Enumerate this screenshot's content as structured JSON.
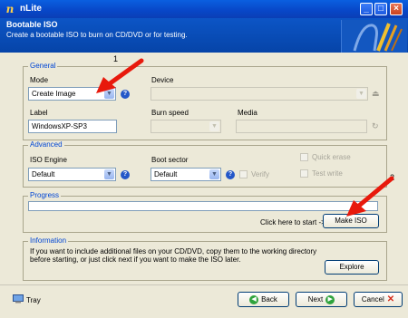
{
  "window": {
    "title": "nLite",
    "minimize": "_",
    "maximize": "□",
    "close": "×"
  },
  "header": {
    "title": "Bootable ISO",
    "subtitle": "Create a bootable ISO to burn on CD/DVD or for testing."
  },
  "general": {
    "label": "General",
    "mode_label": "Mode",
    "mode_value": "Create Image",
    "device_label": "Device",
    "device_value": "",
    "label_label": "Label",
    "label_value": "WindowsXP-SP3",
    "burn_speed_label": "Burn speed",
    "media_label": "Media"
  },
  "advanced": {
    "label": "Advanced",
    "iso_engine_label": "ISO Engine",
    "iso_engine_value": "Default",
    "boot_sector_label": "Boot sector",
    "boot_sector_value": "Default",
    "verify_label": "Verify",
    "quick_erase_label": "Quick erase",
    "test_write_label": "Test write"
  },
  "progress": {
    "label": "Progress",
    "click_text": "Click here to start ->",
    "make_iso_label": "Make ISO",
    "value": 0
  },
  "information": {
    "label": "Information",
    "text_line1": "If you want to include additional files on your CD/DVD, copy them to the working directory",
    "text_line2": "before starting, or just click next if you want to make the ISO later.",
    "explore_label": "Explore"
  },
  "footer": {
    "tray_label": "Tray",
    "back_label": "Back",
    "next_label": "Next",
    "cancel_label": "Cancel"
  },
  "annotations": {
    "marker1": "1",
    "marker2": "2"
  },
  "colors": {
    "accent_red": "#e8190c",
    "header_blue": "#0c55c6",
    "group_label_blue": "#0046d5"
  }
}
